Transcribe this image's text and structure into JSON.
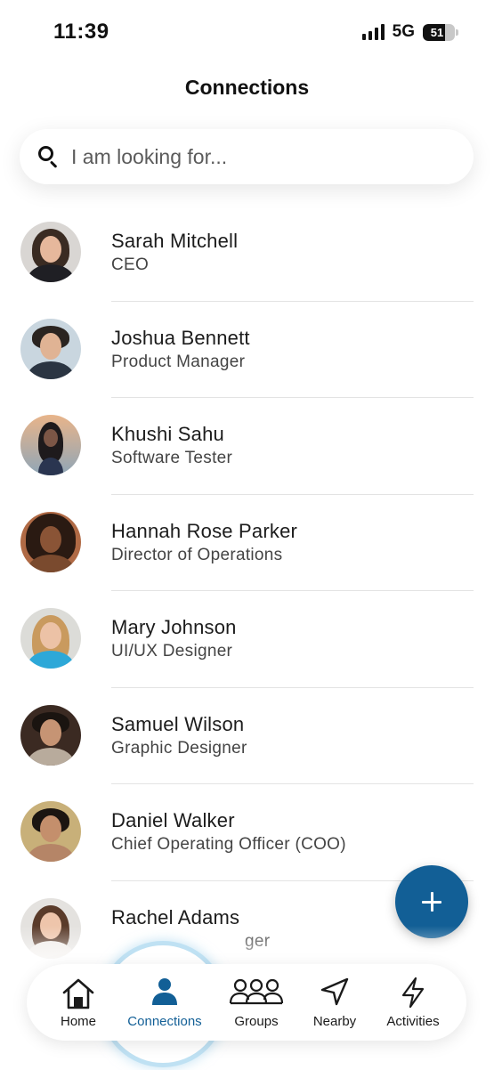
{
  "status_bar": {
    "time": "11:39",
    "network": "5G",
    "battery": "51"
  },
  "header": {
    "title": "Connections"
  },
  "search": {
    "placeholder": "I am looking for..."
  },
  "contacts": [
    {
      "name": "Sarah Mitchell",
      "role": "CEO"
    },
    {
      "name": "Joshua Bennett",
      "role": "Product Manager"
    },
    {
      "name": "Khushi Sahu",
      "role": "Software Tester"
    },
    {
      "name": "Hannah Rose Parker",
      "role": "Director of Operations"
    },
    {
      "name": "Mary Johnson",
      "role": "UI/UX Designer"
    },
    {
      "name": "Samuel Wilson",
      "role": "Graphic Designer"
    },
    {
      "name": "Daniel Walker",
      "role": "Chief Operating Officer (COO)"
    },
    {
      "name": "Rachel Adams",
      "role": "ger"
    }
  ],
  "fab": {
    "icon": "plus-icon"
  },
  "nav": {
    "items": [
      {
        "label": "Home",
        "icon": "home-icon"
      },
      {
        "label": "Connections",
        "icon": "person-icon",
        "active": true
      },
      {
        "label": "Groups",
        "icon": "groups-icon"
      },
      {
        "label": "Nearby",
        "icon": "navigation-arrow-icon"
      },
      {
        "label": "Activities",
        "icon": "lightning-icon"
      }
    ]
  },
  "colors": {
    "accent": "#125f96",
    "active_ring": "#bfe1f3",
    "divider": "#e3e3e3"
  }
}
